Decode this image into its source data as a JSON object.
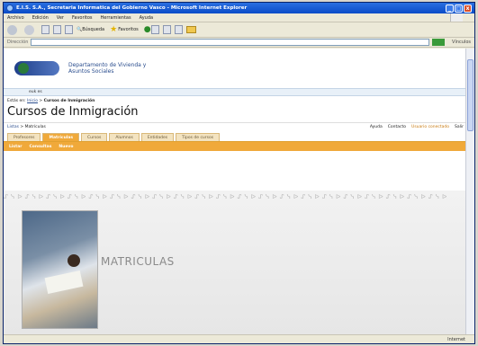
{
  "window": {
    "title": "E.I.S. S.A., Secretaria Informatica del Gobierno Vasco - Microsoft Internet Explorer",
    "min": "_",
    "max": "□",
    "close": "x"
  },
  "menu": [
    "Archivo",
    "Edición",
    "Ver",
    "Favoritos",
    "Herramientas",
    "Ayuda"
  ],
  "toolbar": {
    "search": "Búsqueda",
    "favorites": "Favoritos"
  },
  "address": {
    "label": "Dirección",
    "links": "Vínculos"
  },
  "site": {
    "department": "Departamento de Vivienda y Asuntos Sociales",
    "sitebar": "euk  es",
    "breadcrumb_prefix": "Estás en:",
    "breadcrumb_link": "Inicio",
    "breadcrumb_sep": ">",
    "breadcrumb_current": "Cursos de Inmigración",
    "title": "Cursos de Inmigración",
    "sub_left_link": "Listas",
    "sub_left_current": "Matrículas",
    "sub_right": [
      "Ayuda",
      "Contacto"
    ],
    "sub_user": "Usuario conectado",
    "sub_exit": "Salir"
  },
  "tabs": [
    "Profesores",
    "Matrículas",
    "Cursos",
    "Alumnos",
    "Entidades",
    "Tipos de cursos"
  ],
  "actions": [
    "Listar",
    "Consultas",
    "Nuevo"
  ],
  "main": {
    "heading": "MATRICULAS"
  },
  "status": {
    "zone": "Internet"
  }
}
